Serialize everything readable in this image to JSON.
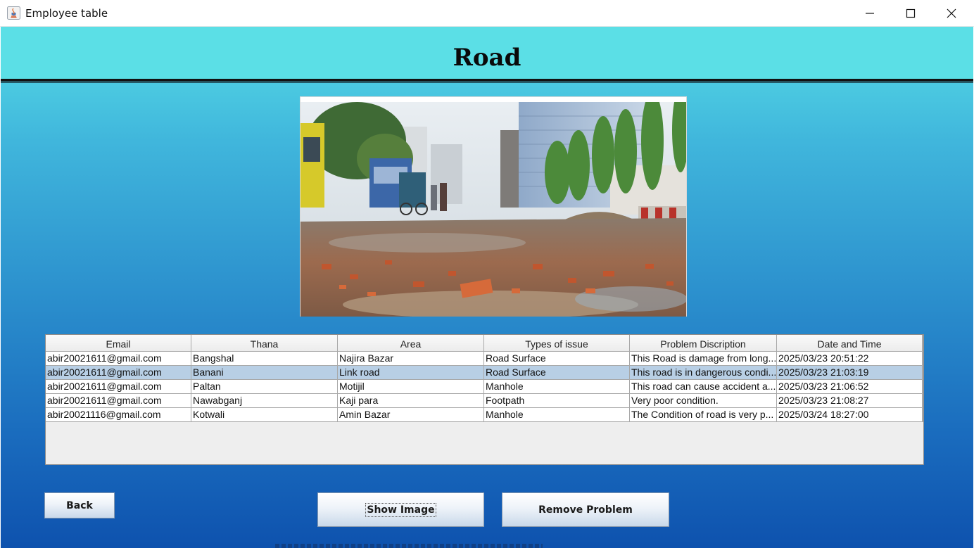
{
  "window": {
    "title": "Employee table",
    "minimize_icon": "minimize-icon",
    "maximize_icon": "maximize-icon",
    "close_icon": "close-icon"
  },
  "page": {
    "title": "Road"
  },
  "image": {
    "subject": "road-photo",
    "accent": "#5bdfe6"
  },
  "table": {
    "columns": [
      "Email",
      "Thana",
      "Area",
      "Types of issue",
      "Problem Discription",
      "Date and Time"
    ],
    "selected_row": 1,
    "rows": [
      [
        "abir20021611@gmail.com",
        "Bangshal",
        "Najira Bazar",
        "Road Surface",
        "This Road is damage from long...",
        "2025/03/23 20:51:22"
      ],
      [
        "abir20021611@gmail.com",
        "Banani",
        "Link road",
        "Road Surface",
        "This road is in dangerous condi...",
        "2025/03/23 21:03:19"
      ],
      [
        "abir20021611@gmail.com",
        "Paltan",
        "Motijil",
        "Manhole",
        "This road can cause accident a...",
        "2025/03/23 21:06:52"
      ],
      [
        "abir20021611@gmail.com",
        "Nawabganj",
        "Kaji para",
        "Footpath",
        "Very poor condition.",
        "2025/03/23 21:08:27"
      ],
      [
        "abir20021116@gmail.com",
        "Kotwali",
        "Amin Bazar",
        "Manhole",
        "The Condition of road is very p...",
        "2025/03/24 18:27:00"
      ]
    ]
  },
  "buttons": {
    "back": "Back",
    "show_image": "Show Image",
    "remove_problem": "Remove Problem"
  }
}
